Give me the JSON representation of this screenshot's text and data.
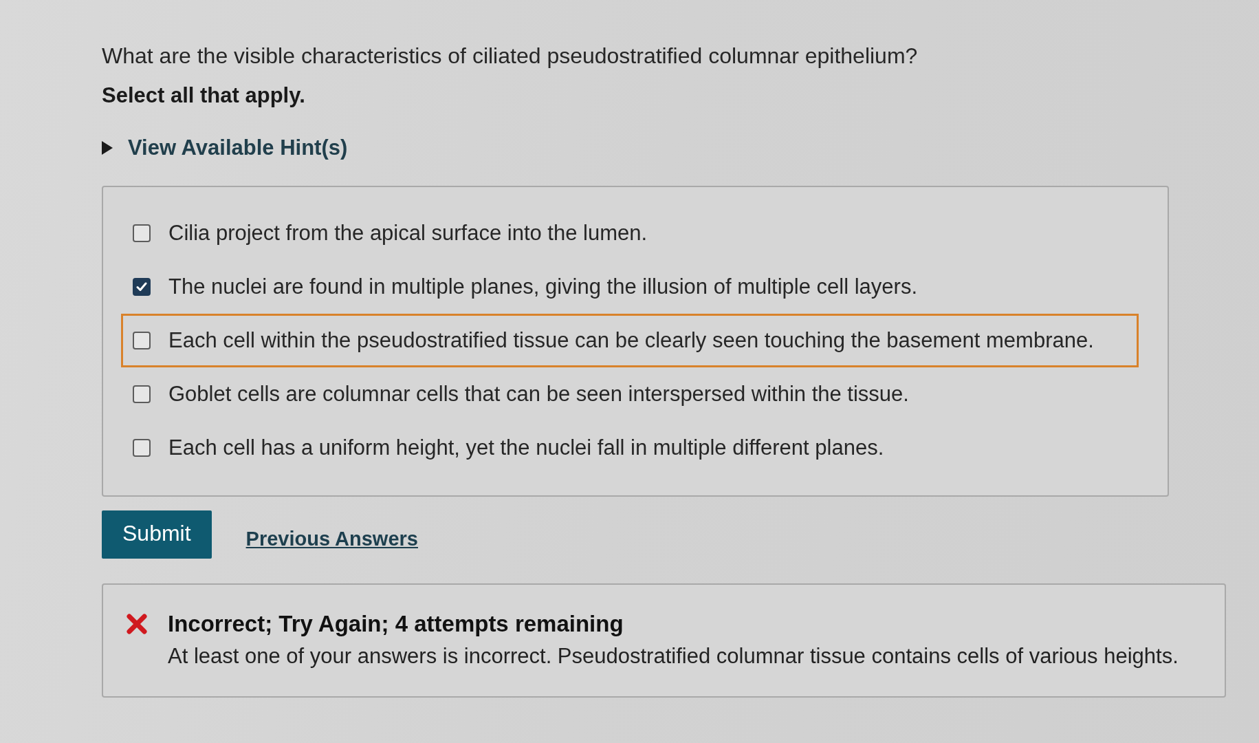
{
  "question": {
    "text": "What are the visible characteristics of ciliated pseudostratified columnar epithelium?",
    "instruction": "Select all that apply."
  },
  "hint": {
    "label": "View Available Hint(s)",
    "expanded": false
  },
  "options": [
    {
      "label": "Cilia project from the apical surface into the lumen.",
      "checked": false,
      "focused": false
    },
    {
      "label": "The nuclei are found in multiple planes, giving the illusion of multiple cell layers.",
      "checked": true,
      "focused": false
    },
    {
      "label": "Each cell within the pseudostratified tissue can be clearly seen touching the basement membrane.",
      "checked": false,
      "focused": true
    },
    {
      "label": "Goblet cells are columnar cells that can be seen interspersed within the tissue.",
      "checked": false,
      "focused": false
    },
    {
      "label": "Each cell has a uniform height, yet the nuclei fall in multiple different planes.",
      "checked": false,
      "focused": false
    }
  ],
  "actions": {
    "submit": "Submit",
    "previous_answers": "Previous Answers"
  },
  "feedback": {
    "kind": "incorrect",
    "title": "Incorrect; Try Again; 4 attempts remaining",
    "message": "At least one of your answers is incorrect. Pseudostratified columnar tissue contains cells of various heights."
  }
}
